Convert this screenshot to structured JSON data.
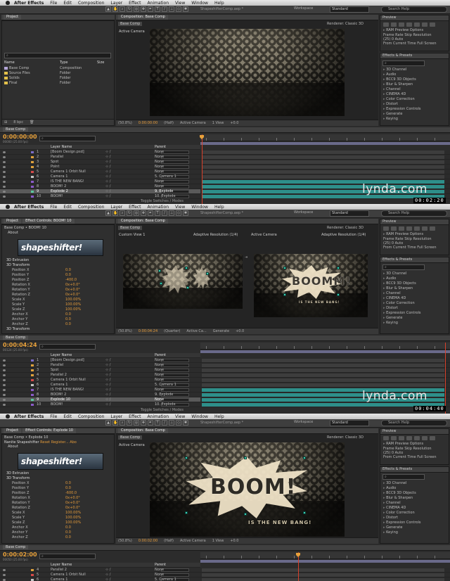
{
  "menu": {
    "items": [
      "After Effects",
      "File",
      "Edit",
      "Composition",
      "Layer",
      "Effect",
      "Animation",
      "View",
      "Window",
      "Help"
    ]
  },
  "title": "ShapeshifterComp.aep *",
  "workspace": {
    "label": "Workspace",
    "value": "Standard"
  },
  "search": {
    "placeholder": "Search Help"
  },
  "preview": {
    "title": "Preview",
    "ram": "RAM Preview Options",
    "frame_rate": "Frame Rate",
    "skip": "Skip",
    "resolution": "Resolution",
    "fr_val": "(25)",
    "skip_val": "0",
    "res_val": "Auto",
    "from": "From Current Time",
    "full": "Full Screen"
  },
  "effects": {
    "title": "Effects & Presets",
    "items": [
      "3D Channel",
      "Audio",
      "BCC9 3D Objects",
      "Blur & Sharpen",
      "Channel",
      "CINEMA 4D",
      "Color Correction",
      "Distort",
      "Expression Controls",
      "Generate",
      "Keying"
    ]
  },
  "brand": {
    "name": "lynda",
    "suffix": ".com"
  },
  "frame1": {
    "timestamp": "00:02:20",
    "project": {
      "title": "Project",
      "cols": [
        "Name",
        "Type",
        "Size"
      ],
      "rows": [
        {
          "name": "Base Comp",
          "type": "Composition",
          "color": "#b4a6d8"
        },
        {
          "name": "Source Files",
          "type": "Folder",
          "color": "#e3c14a"
        },
        {
          "name": "Solids",
          "type": "Folder",
          "color": "#e3c14a"
        },
        {
          "name": "Final",
          "type": "Folder",
          "color": "#e3c14a"
        }
      ]
    },
    "comp_tab": "Composition: Base Comp",
    "breadcrumb": "Base Comp",
    "renderer": "Renderer:  Classic 3D",
    "active_camera": "Active Camera",
    "viewer_bar": [
      "(50.8%)",
      "0:00:00:00",
      "(Half)",
      "Active Camera",
      "1 View",
      "+0.0"
    ],
    "timeline": {
      "tab": "Base Comp",
      "timecode": "0:00:00:00",
      "sub": "00000 (25.00 fps)",
      "col_name": "Layer Name",
      "col_parent": "Parent",
      "layers": [
        {
          "num": "1",
          "name": "[Boom Design.psd]",
          "parent": "None",
          "color": "#7c6cc8"
        },
        {
          "num": "2",
          "name": "Parallel",
          "parent": "None",
          "color": "#e0a23c"
        },
        {
          "num": "3",
          "name": "Spot",
          "parent": "None",
          "color": "#e0a23c"
        },
        {
          "num": "4",
          "name": "Point",
          "parent": "None",
          "color": "#e0a23c"
        },
        {
          "num": "5",
          "name": "Camera 1 Orbit Null",
          "parent": "None",
          "color": "#d64a4a"
        },
        {
          "num": "6",
          "name": "Camera 1",
          "parent": "5. Camera 1",
          "color": "#c6c6c6"
        },
        {
          "num": "7",
          "name": "IS THE NEW BANG!",
          "parent": "None",
          "color": "#8a5ac8"
        },
        {
          "num": "8",
          "name": "BOOM! 2",
          "parent": "None",
          "color": "#8a5ac8"
        },
        {
          "num": "9",
          "name": "Explode 2",
          "parent": "9. Explode",
          "color": "#5ac8a0",
          "selected": true
        },
        {
          "num": "10",
          "name": "BOOM!",
          "parent": "10. Explode",
          "color": "#8a5ac8"
        }
      ],
      "toggle": "Toggle Switches / Modes"
    }
  },
  "frame2": {
    "timestamp": "00:04:40",
    "ec_tab": "Effect Controls: BOOM! 10",
    "ec_path": "Base Comp • BOOM! 10",
    "ec_about": "About",
    "plugin_logo": "shapeshifter!",
    "ec_rows": [
      {
        "label": "3D Extrusion",
        "value": ""
      },
      {
        "label": "3D Transform",
        "value": ""
      },
      {
        "label": "Position X",
        "value": "0.0"
      },
      {
        "label": "Position Y",
        "value": "0.0"
      },
      {
        "label": "Position Z",
        "value": "-400.0"
      },
      {
        "label": "Rotation X",
        "value": "0x+0.0°"
      },
      {
        "label": "Rotation Y",
        "value": "0x+0.0°"
      },
      {
        "label": "Rotation Z",
        "value": "0x+0.0°"
      },
      {
        "label": "Scale X",
        "value": "100.00%"
      },
      {
        "label": "Scale Y",
        "value": "100.00%"
      },
      {
        "label": "Scale Z",
        "value": "100.00%"
      },
      {
        "label": "Anchor X",
        "value": "0.0"
      },
      {
        "label": "Anchor Y",
        "value": "0.0"
      },
      {
        "label": "Anchor Z",
        "value": "0.0"
      },
      {
        "label": "3D Transform",
        "value": ""
      }
    ],
    "custom_view": "Custom View 1",
    "adaptive": "Adaptive Resolution (1/4)",
    "active_camera": "Active Camera",
    "adaptive2": "Adaptive Resolution (1/4)",
    "comp_text": "BOOMM!",
    "comp_sub": "IS THE NEW BANG!",
    "viewer_bar": [
      "(50.8%)",
      "0:00:04:24",
      "(Quarter)",
      "Active Ca...",
      "Generate",
      "+0.0"
    ],
    "timeline": {
      "tab": "Base Comp",
      "timecode": "0:00:04:24",
      "sub": "00124 (25.00 fps)",
      "col_name": "Layer Name",
      "col_parent": "Parent",
      "layers": [
        {
          "num": "1",
          "name": "[Boom Design.psd]",
          "parent": "None",
          "color": "#7c6cc8"
        },
        {
          "num": "2",
          "name": "Parallel",
          "parent": "None",
          "color": "#e0a23c"
        },
        {
          "num": "3",
          "name": "Spot",
          "parent": "None",
          "color": "#e0a23c"
        },
        {
          "num": "4",
          "name": "Parallel 2",
          "parent": "None",
          "color": "#e0a23c"
        },
        {
          "num": "5",
          "name": "Camera 1 Orbit Null",
          "parent": "None",
          "color": "#d64a4a"
        },
        {
          "num": "6",
          "name": "Camera 1",
          "parent": "5. Camera 1",
          "color": "#c6c6c6"
        },
        {
          "num": "7",
          "name": "IS THE NEW BANG!",
          "parent": "None",
          "color": "#8a5ac8"
        },
        {
          "num": "8",
          "name": "BOOM! 2",
          "parent": "9. Explode",
          "color": "#8a5ac8"
        },
        {
          "num": "9",
          "name": "Explode 10",
          "parent": "None",
          "color": "#5ac8a0",
          "selected": true
        },
        {
          "num": "10",
          "name": "BOOM!",
          "parent": "10. Explode",
          "color": "#8a5ac8"
        }
      ],
      "toggle": "Toggle Switches / Modes"
    }
  },
  "frame3": {
    "ec_tab": "Effect Controls: Explode 10",
    "ec_path": "Base Comp • Explode 10",
    "ec_line": "Reset  Register...  Abo",
    "ec_about": "About",
    "plugin_name": "Nanite Shapeshifter",
    "plugin_logo": "shapeshifter!",
    "ec_rows": [
      {
        "label": "3D Extrusion",
        "value": ""
      },
      {
        "label": "3D Transform",
        "value": ""
      },
      {
        "label": "Position X",
        "value": "0.0"
      },
      {
        "label": "Position Y",
        "value": "0.0"
      },
      {
        "label": "Position Z",
        "value": "-600.0"
      },
      {
        "label": "Rotation X",
        "value": "0x+0.0°"
      },
      {
        "label": "Rotation Y",
        "value": "0x+0.0°"
      },
      {
        "label": "Rotation Z",
        "value": "0x+0.0°"
      },
      {
        "label": "Scale X",
        "value": "100.00%"
      },
      {
        "label": "Scale Y",
        "value": "100.00%"
      },
      {
        "label": "Scale Z",
        "value": "100.00%"
      },
      {
        "label": "Anchor X",
        "value": "0.0"
      },
      {
        "label": "Anchor Y",
        "value": "0.0"
      },
      {
        "label": "Anchor Z",
        "value": "0.0"
      }
    ],
    "comp_tab": "Composition: Base Comp",
    "breadcrumb": "Base Comp",
    "renderer": "Renderer:  Classic 3D",
    "active_camera": "Active Camera",
    "comp_text": "BOOM!",
    "comp_sub": "IS THE NEW BANG!",
    "viewer_bar": [
      "(50.8%)",
      "0:00:02:00",
      "(Half)",
      "Active Camera",
      "1 View",
      "+0.0"
    ],
    "timeline": {
      "tab": "Base Comp",
      "timecode": "0:00:02:00",
      "sub": "00050 (25.00 fps)",
      "col_name": "Layer Name",
      "col_parent": "Parent",
      "layers": [
        {
          "num": "4",
          "name": "Parallel 2",
          "parent": "None",
          "color": "#e0a23c"
        },
        {
          "num": "5",
          "name": "Camera 1 Orbit Null",
          "parent": "None",
          "color": "#d64a4a"
        },
        {
          "num": "6",
          "name": "Camera 1",
          "parent": "5. Camera 1",
          "color": "#c6c6c6"
        }
      ]
    }
  }
}
